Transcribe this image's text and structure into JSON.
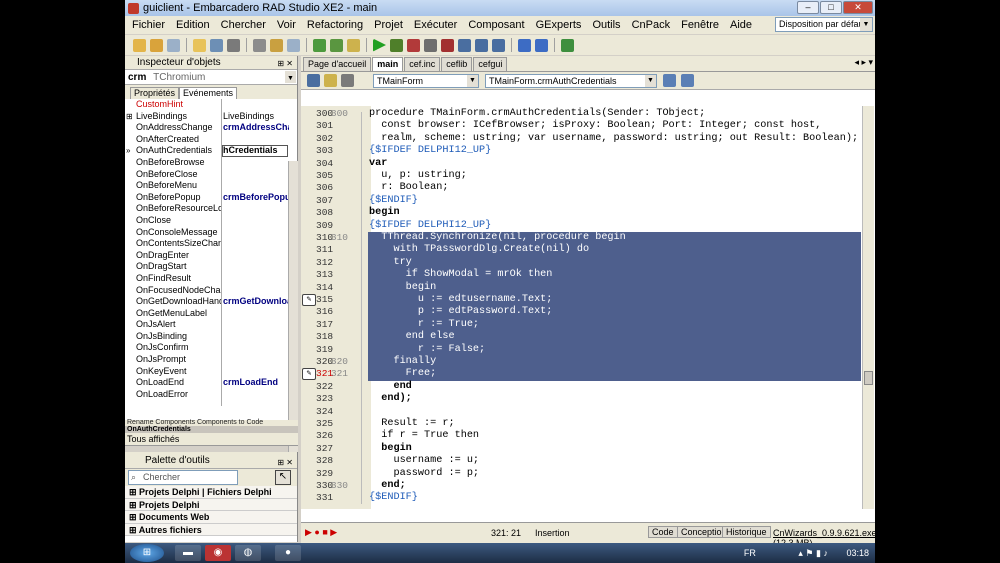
{
  "window": {
    "title": "guiclient - Embarcadero RAD Studio XE2 - main"
  },
  "menu": [
    "Fichier",
    "Edition",
    "Chercher",
    "Voir",
    "Refactoring",
    "Projet",
    "Exécuter",
    "Composant",
    "GExperts",
    "Outils",
    "CnPack",
    "Fenêtre",
    "Aide"
  ],
  "layout_select": "Disposition par défaut",
  "inspector": {
    "title": "Inspecteur d'objets",
    "object_name": "crm",
    "object_type": "TChromium",
    "tab_properties": "Propriétés",
    "tab_events": "Evénements",
    "rows": [
      {
        "name": "CustomHint",
        "value": "",
        "exp": ""
      },
      {
        "name": "LiveBindings",
        "value": "LiveBindings",
        "exp": "⊞"
      },
      {
        "name": "OnAddressChange",
        "value": "crmAddressCha",
        "exp": ""
      },
      {
        "name": "OnAfterCreated",
        "value": "",
        "exp": ""
      },
      {
        "name": "OnAuthCredentials",
        "value": "hCredentials",
        "exp": "»"
      },
      {
        "name": "OnBeforeBrowse",
        "value": "",
        "exp": ""
      },
      {
        "name": "OnBeforeClose",
        "value": "",
        "exp": ""
      },
      {
        "name": "OnBeforeMenu",
        "value": "",
        "exp": ""
      },
      {
        "name": "OnBeforePopup",
        "value": "crmBeforePopu",
        "exp": ""
      },
      {
        "name": "OnBeforeResourceLoad",
        "value": "",
        "exp": ""
      },
      {
        "name": "OnClose",
        "value": "",
        "exp": ""
      },
      {
        "name": "OnConsoleMessage",
        "value": "",
        "exp": ""
      },
      {
        "name": "OnContentsSizeChange",
        "value": "",
        "exp": ""
      },
      {
        "name": "OnDragEnter",
        "value": "",
        "exp": ""
      },
      {
        "name": "OnDragStart",
        "value": "",
        "exp": ""
      },
      {
        "name": "OnFindResult",
        "value": "",
        "exp": ""
      },
      {
        "name": "OnFocusedNodeChange",
        "value": "",
        "exp": ""
      },
      {
        "name": "OnGetDownloadHandler",
        "value": "crmGetDownloa",
        "exp": ""
      },
      {
        "name": "OnGetMenuLabel",
        "value": "",
        "exp": ""
      },
      {
        "name": "OnJsAlert",
        "value": "",
        "exp": ""
      },
      {
        "name": "OnJsBinding",
        "value": "",
        "exp": ""
      },
      {
        "name": "OnJsConfirm",
        "value": "",
        "exp": ""
      },
      {
        "name": "OnJsPrompt",
        "value": "",
        "exp": ""
      },
      {
        "name": "OnKeyEvent",
        "value": "",
        "exp": ""
      },
      {
        "name": "OnLoadEnd",
        "value": "crmLoadEnd",
        "exp": ""
      },
      {
        "name": "OnLoadError",
        "value": "",
        "exp": ""
      }
    ],
    "footer_links": "Rename Components    Components to Code",
    "footer_selected": "OnAuthCredentials",
    "footer_shown": "Tous affichés"
  },
  "palette": {
    "title": "Palette d'outils",
    "search_placeholder": "Chercher",
    "categories": [
      "Projets Delphi | Fichiers Delphi",
      "Projets Delphi",
      "Documents Web",
      "Autres fichiers"
    ]
  },
  "editor": {
    "tabs": [
      "Page d'accueil",
      "main",
      "cef.inc",
      "ceflib",
      "cefgui"
    ],
    "unit_combo": "TMainForm",
    "method_combo": "TMainForm.crmAuthCredentials",
    "lines": [
      {
        "n": "300",
        "i": "300",
        "t": "procedure TMainForm.crmAuthCredentials(Sender: TObject;"
      },
      {
        "n": "301",
        "i": "",
        "t": "  const browser: ICefBrowser; isProxy: Boolean; Port: Integer; const host,"
      },
      {
        "n": "302",
        "i": "",
        "t": "  realm, scheme: ustring; var username, password: ustring; out Result: Boolean);"
      },
      {
        "n": "303",
        "i": "",
        "t": "{$IFDEF DELPHI12_UP}"
      },
      {
        "n": "304",
        "i": "",
        "t": "var"
      },
      {
        "n": "305",
        "i": "",
        "t": "  u, p: ustring;"
      },
      {
        "n": "306",
        "i": "",
        "t": "  r: Boolean;"
      },
      {
        "n": "307",
        "i": "",
        "t": "{$ENDIF}"
      },
      {
        "n": "308",
        "i": "",
        "t": "begin"
      },
      {
        "n": "309",
        "i": "",
        "t": "{$IFDEF DELPHI12_UP}"
      },
      {
        "n": "310",
        "i": "310",
        "t": "  TThread.Synchronize(nil, procedure begin"
      },
      {
        "n": "311",
        "i": "",
        "t": "    with TPasswordDlg.Create(nil) do"
      },
      {
        "n": "312",
        "i": "",
        "t": "    try"
      },
      {
        "n": "313",
        "i": "",
        "t": "      if ShowModal = mrOk then"
      },
      {
        "n": "314",
        "i": "",
        "t": "      begin"
      },
      {
        "n": "315",
        "i": "",
        "t": "        u := edtusername.Text;"
      },
      {
        "n": "316",
        "i": "",
        "t": "        p := edtPassword.Text;"
      },
      {
        "n": "317",
        "i": "",
        "t": "        r := True;"
      },
      {
        "n": "318",
        "i": "",
        "t": "      end else"
      },
      {
        "n": "319",
        "i": "",
        "t": "        r := False;"
      },
      {
        "n": "320",
        "i": "320",
        "t": "    finally"
      },
      {
        "n": "321",
        "i": "321",
        "t": "      Free;"
      },
      {
        "n": "322",
        "i": "",
        "t": "    end"
      },
      {
        "n": "323",
        "i": "",
        "t": "  end);"
      },
      {
        "n": "324",
        "i": "",
        "t": ""
      },
      {
        "n": "325",
        "i": "",
        "t": "  Result := r;"
      },
      {
        "n": "326",
        "i": "",
        "t": "  if r = True then"
      },
      {
        "n": "327",
        "i": "",
        "t": "  begin"
      },
      {
        "n": "328",
        "i": "",
        "t": "    username := u;"
      },
      {
        "n": "329",
        "i": "",
        "t": "    password := p;"
      },
      {
        "n": "330",
        "i": "330",
        "t": "  end;"
      },
      {
        "n": "331",
        "i": "",
        "t": "{$ENDIF}"
      }
    ]
  },
  "status": {
    "position": "321: 21",
    "mode": "Insertion",
    "tab_code": "Code",
    "tab_design": "Conception",
    "tab_history": "Historique",
    "cnwizards": "CnWizards_0.9.9.621.exe (12,3 MB)"
  },
  "taskbar": {
    "lang": "FR",
    "time": "03:18"
  }
}
